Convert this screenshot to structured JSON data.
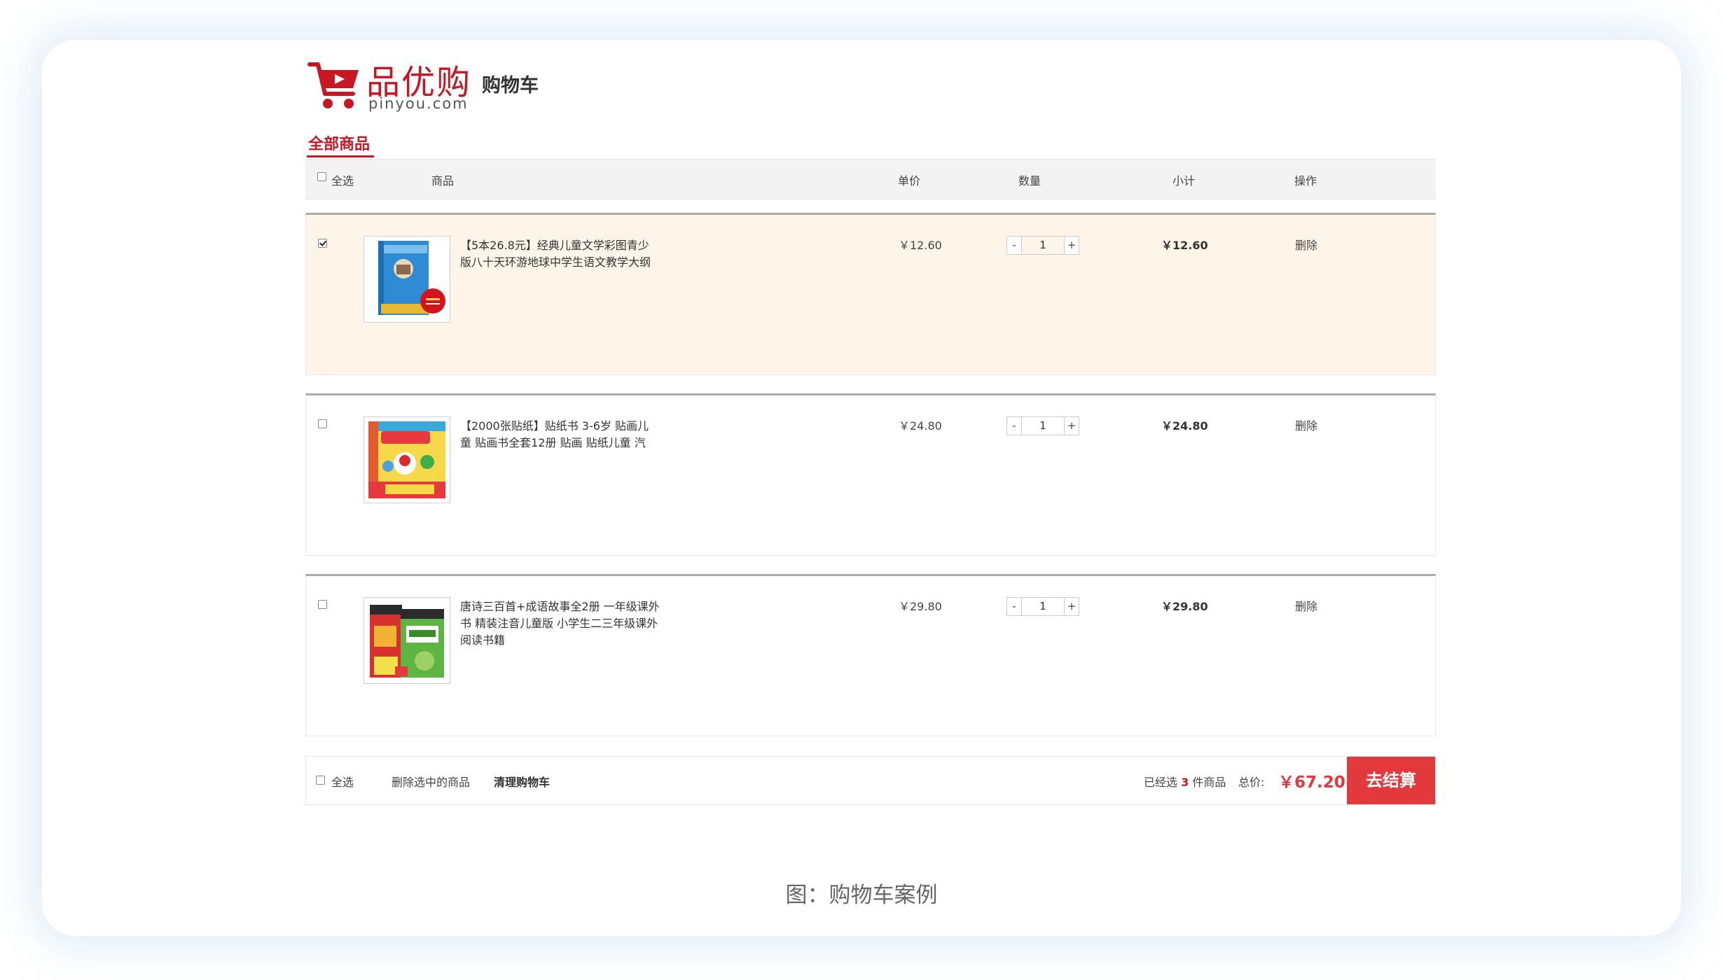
{
  "brand": {
    "name_cn": "品优购",
    "domain": "pinyou.com",
    "page_title": "购物车",
    "color": "#c81623"
  },
  "tabs": {
    "all_items": "全部商品"
  },
  "table_header": {
    "select_all": "全选",
    "product": "商品",
    "unit_price": "单价",
    "quantity": "数量",
    "subtotal": "小计",
    "action": "操作"
  },
  "items": [
    {
      "selected": true,
      "name": "【5本26.8元】经典儿童文学彩图青少版八十天环游地球中学生语文教学大纲",
      "unit_price": "￥12.60",
      "quantity": "1",
      "subtotal": "￥12.60",
      "delete": "删除",
      "minus": "-",
      "plus": "+"
    },
    {
      "selected": false,
      "name": "【2000张贴纸】贴纸书 3-6岁 贴画儿童 贴画书全套12册 贴画 贴纸儿童 汽",
      "unit_price": "￥24.80",
      "quantity": "1",
      "subtotal": "￥24.80",
      "delete": "删除",
      "minus": "-",
      "plus": "+"
    },
    {
      "selected": false,
      "name": "唐诗三百首+成语故事全2册 一年级课外书 精装注音儿童版 小学生二三年级课外阅读书籍",
      "unit_price": "￥29.80",
      "quantity": "1",
      "subtotal": "￥29.80",
      "delete": "删除",
      "minus": "-",
      "plus": "+"
    }
  ],
  "footer": {
    "select_all": "全选",
    "delete_selected": "删除选中的商品",
    "clear_cart": "清理购物车",
    "selected_prefix": "已经选",
    "selected_count": "3",
    "selected_suffix": "件商品",
    "total_label": "总价:",
    "total_value": "￥67.20",
    "checkout": "去结算"
  },
  "caption": "图：购物车案例",
  "colors": {
    "accent": "#e4393c",
    "selected_row": "#fff4e8",
    "header_bg": "#f3f3f3"
  }
}
